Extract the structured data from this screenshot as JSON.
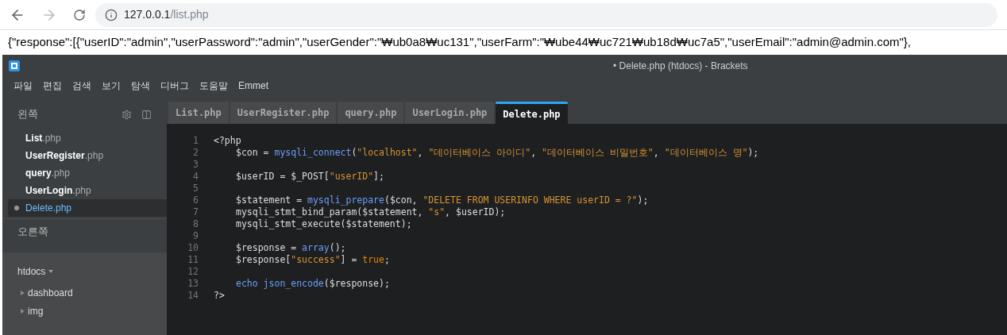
{
  "browser": {
    "back_disabled": false,
    "forward_disabled": true,
    "url_host": "127.0.0.1",
    "url_path": "/list.php"
  },
  "page_text": "{\"response\":[{\"userID\":\"admin\",\"userPassword\":\"admin\",\"userGender\":\"₩ub0a8₩uc131\",\"userFarm\":\"₩ube44₩uc721₩ub18d₩uc7a5\",\"userEmail\":\"admin@admin.com\"},",
  "window": {
    "title": "• Delete.php (htdocs) - Brackets"
  },
  "menu": [
    "파일",
    "편집",
    "검색",
    "보기",
    "탐색",
    "디버그",
    "도움말",
    "Emmet"
  ],
  "sidebar": {
    "left_heading": "왼쪽",
    "right_heading": "오른쪽",
    "files": [
      {
        "name": "List",
        "ext": ".php",
        "selected": false,
        "dirty": false
      },
      {
        "name": "UserRegister",
        "ext": ".php",
        "selected": false,
        "dirty": false
      },
      {
        "name": "query",
        "ext": ".php",
        "selected": false,
        "dirty": false
      },
      {
        "name": "UserLogin",
        "ext": ".php",
        "selected": false,
        "dirty": false
      },
      {
        "name": "Delete",
        "ext": ".php",
        "selected": true,
        "dirty": true
      }
    ],
    "project": {
      "name": "htdocs",
      "items": [
        {
          "label": "dashboard",
          "expanded": false
        },
        {
          "label": "img",
          "expanded": false
        }
      ]
    }
  },
  "tabs": [
    {
      "label": "List.php",
      "selected": false
    },
    {
      "label": "UserRegister.php",
      "selected": false
    },
    {
      "label": "query.php",
      "selected": false
    },
    {
      "label": "UserLogin.php",
      "selected": false
    },
    {
      "label": "Delete.php",
      "selected": true
    }
  ],
  "code": [
    {
      "number": "1",
      "indented": false,
      "tokens": [
        {
          "kind": "meta",
          "text": "<?php"
        }
      ]
    },
    {
      "number": "2",
      "indented": true,
      "tokens": [
        {
          "kind": "plain",
          "text": "$con = "
        },
        {
          "kind": "func",
          "text": "mysqli_connect"
        },
        {
          "kind": "plain",
          "text": "("
        },
        {
          "kind": "string",
          "text": "\"localhost\""
        },
        {
          "kind": "plain",
          "text": ", "
        },
        {
          "kind": "string",
          "text": "\"데이터베이스 아이디\""
        },
        {
          "kind": "plain",
          "text": ", "
        },
        {
          "kind": "string",
          "text": "\"데이터베이스 비밀번호\""
        },
        {
          "kind": "plain",
          "text": ", "
        },
        {
          "kind": "string",
          "text": "\"데이터베이스 명\""
        },
        {
          "kind": "plain",
          "text": ");"
        }
      ]
    },
    {
      "number": "3"
    },
    {
      "number": "4",
      "indented": true,
      "tokens": [
        {
          "kind": "plain",
          "text": "$userID = $_POST["
        },
        {
          "kind": "string",
          "text": "\"userID\""
        },
        {
          "kind": "plain",
          "text": "];"
        }
      ]
    },
    {
      "number": "5"
    },
    {
      "number": "6",
      "indented": true,
      "tokens": [
        {
          "kind": "plain",
          "text": "$statement = "
        },
        {
          "kind": "func",
          "text": "mysqli_prepare"
        },
        {
          "kind": "plain",
          "text": "($con, "
        },
        {
          "kind": "string",
          "text": "\"DELETE FROM USERINFO WHERE userID = ?\""
        },
        {
          "kind": "plain",
          "text": ");"
        }
      ]
    },
    {
      "number": "7",
      "indented": true,
      "tokens": [
        {
          "kind": "plain",
          "text": "mysqli_stmt_bind_param($statement, "
        },
        {
          "kind": "string",
          "text": "\"s\""
        },
        {
          "kind": "plain",
          "text": ", $userID);"
        }
      ]
    },
    {
      "number": "8",
      "indented": true,
      "tokens": [
        {
          "kind": "plain",
          "text": "mysqli_stmt_execute($statement);"
        }
      ]
    },
    {
      "number": "9"
    },
    {
      "number": "10",
      "indented": true,
      "tokens": [
        {
          "kind": "plain",
          "text": "$response = "
        },
        {
          "kind": "func",
          "text": "array"
        },
        {
          "kind": "plain",
          "text": "();"
        }
      ]
    },
    {
      "number": "11",
      "indented": true,
      "tokens": [
        {
          "kind": "plain",
          "text": "$response["
        },
        {
          "kind": "string",
          "text": "\"success\""
        },
        {
          "kind": "plain",
          "text": "] = "
        },
        {
          "kind": "atom",
          "text": "true"
        },
        {
          "kind": "plain",
          "text": ";"
        }
      ]
    },
    {
      "number": "12"
    },
    {
      "number": "13",
      "indented": true,
      "tokens": [
        {
          "kind": "func",
          "text": "echo json_encode"
        },
        {
          "kind": "plain",
          "text": "($response);"
        }
      ]
    },
    {
      "number": "14",
      "indented": false,
      "tokens": [
        {
          "kind": "meta",
          "text": "?>"
        }
      ]
    }
  ]
}
